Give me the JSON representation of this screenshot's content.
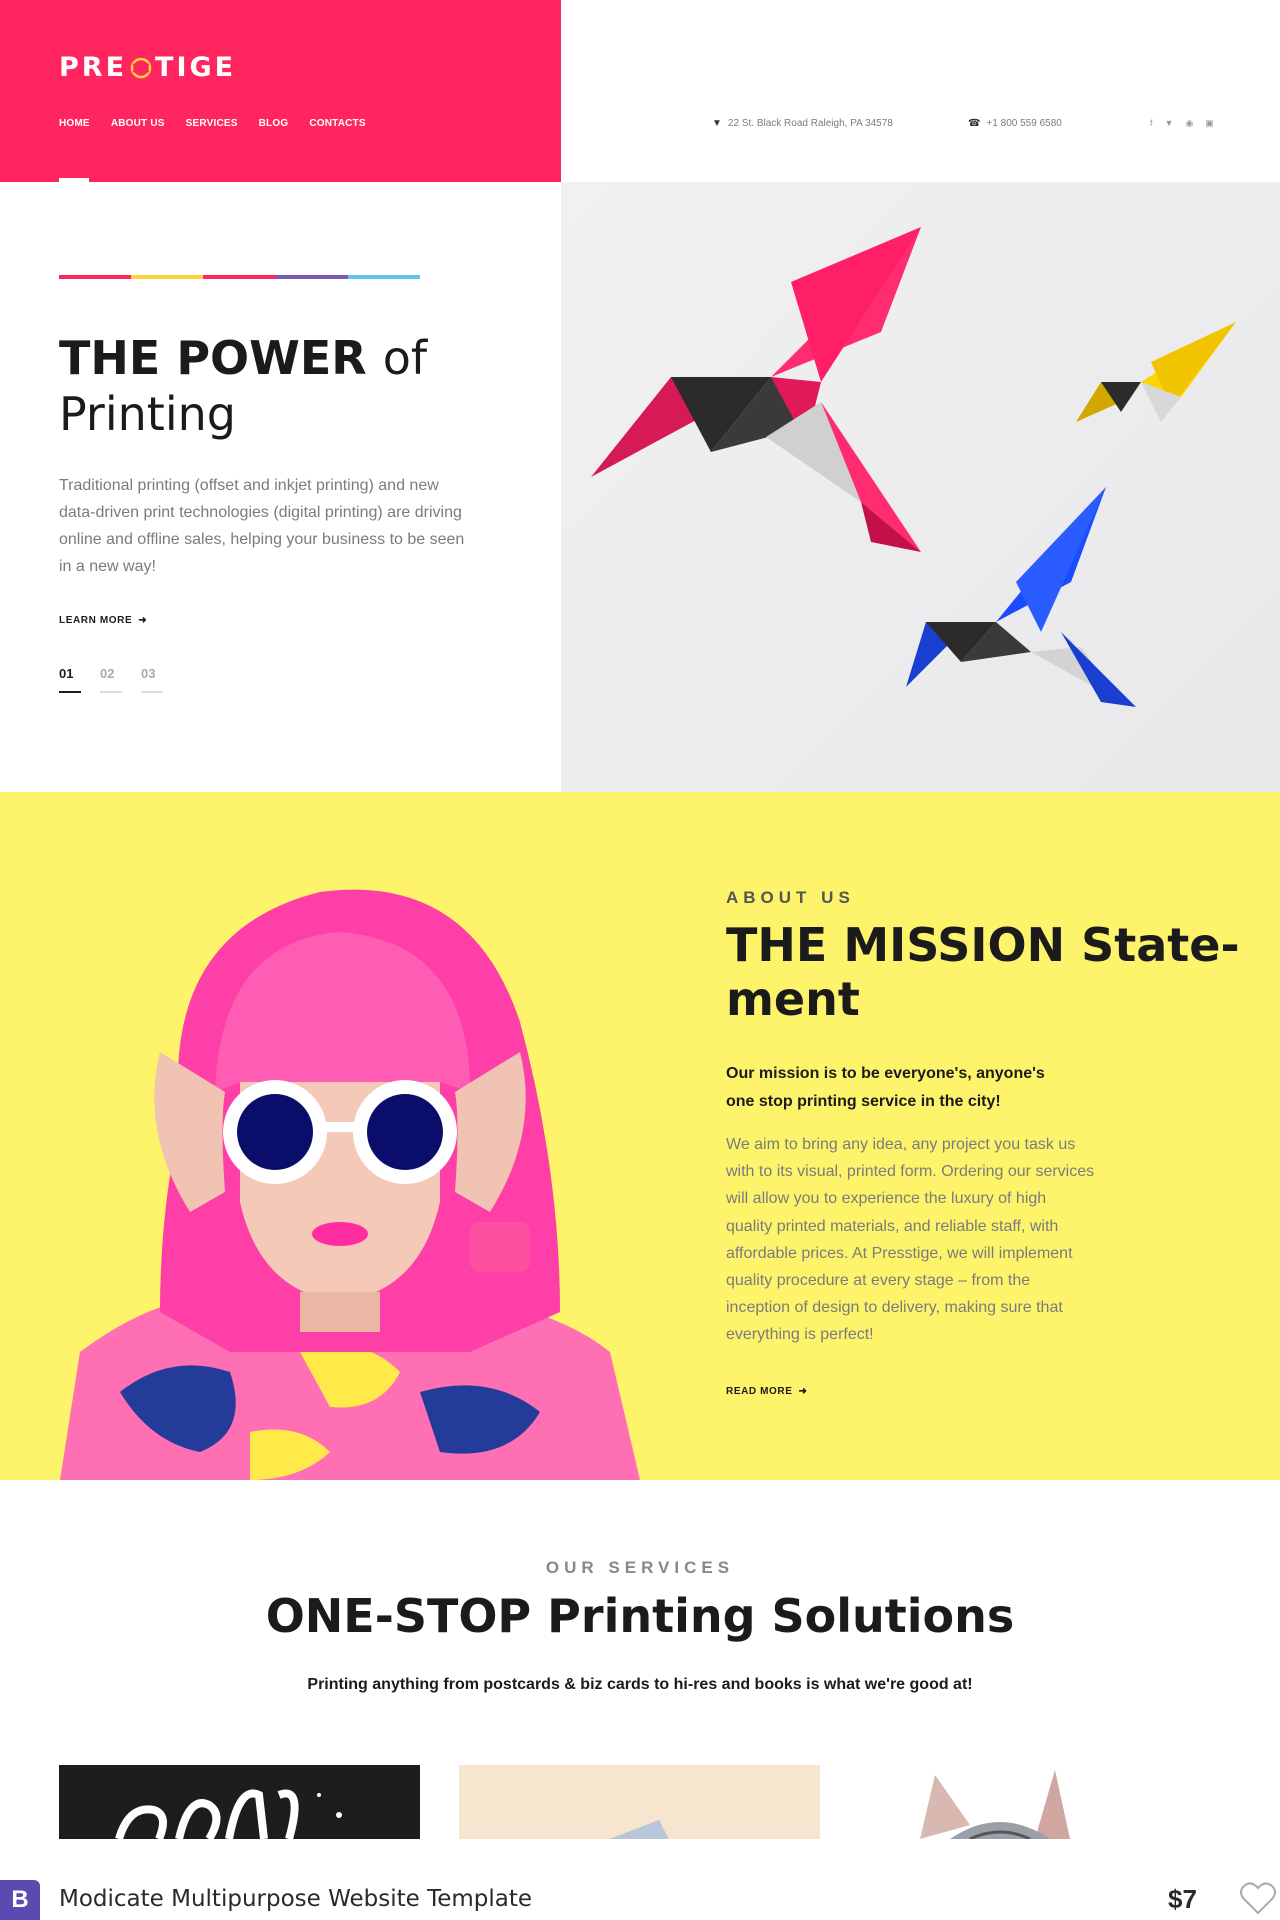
{
  "header": {
    "logo_pre": "PRE",
    "logo_post": "TIGE",
    "nav": [
      "HOME",
      "ABOUT US",
      "SERVICES",
      "BLOG",
      "CONTACTS"
    ],
    "address": "22 St. Black Road Raleigh, PA 34578",
    "phone": "+1 800 559 6580",
    "socials": [
      "facebook-icon",
      "twitter-icon",
      "pinterest-icon",
      "instagram-icon"
    ],
    "brand_color": "#ff2660"
  },
  "hero": {
    "title_bold": "THE POWER",
    "title_light_1": "of",
    "title_light_2": "Printing",
    "text": "Traditional printing (offset and inkjet printing) and new data-driven print technologies (digital printing) are driving online and offline sales, helping your business to be seen in a new way!",
    "cta": "LEARN MORE",
    "slides": [
      "01",
      "02",
      "03"
    ],
    "bar_colors": [
      "#ff2660",
      "#ffd43b",
      "#ff2660",
      "#7b5bb5",
      "#64c3f0"
    ]
  },
  "about": {
    "eyebrow": "ABOUT US",
    "title_bold": "THE MISSION",
    "title_light": "State-ment",
    "lead": "Our mission is to be everyone's, anyone's one stop printing service in the city!",
    "body": "We aim to bring any idea, any project you task us with to its visual, printed form. Ordering our services will allow you to experience the luxury of high quality printed materials, and reliable staff, with affordable prices. At Presstige, we will implement quality procedure at every stage – from the inception of design to delivery, making sure that everything is perfect!",
    "cta": "READ MORE",
    "bg_color": "#fdf46c"
  },
  "services": {
    "eyebrow": "OUR SERVICES",
    "title_bold": "ONE-STOP",
    "title_light": "Printing Solutions",
    "lead": "Printing anything from postcards & biz cards to hi-res and books is what we're good at!"
  },
  "bottom_bar": {
    "icon_letter": "B",
    "title": "Modicate Multipurpose Website Template",
    "price": "$7"
  }
}
